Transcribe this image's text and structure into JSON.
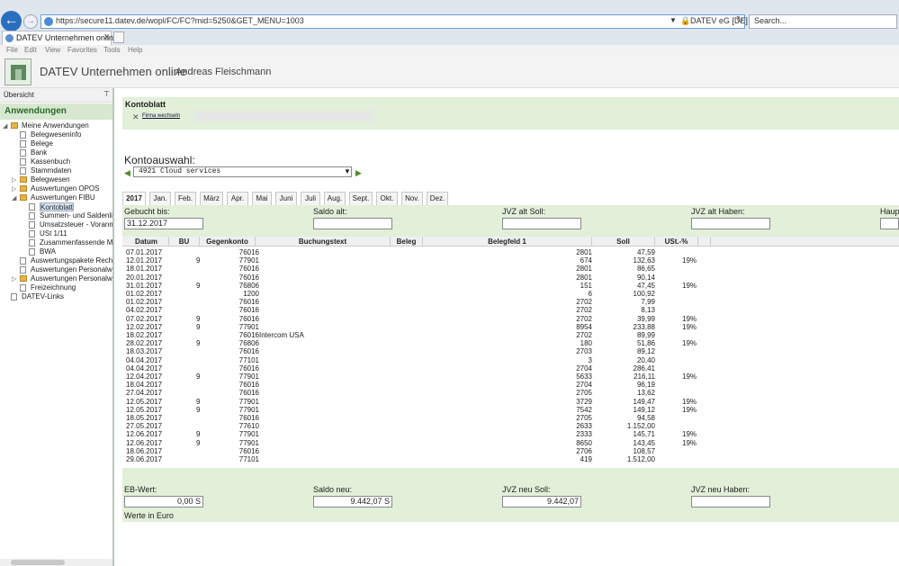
{
  "browser": {
    "url": "https://secure11.datev.de/wopl/FC/FC?mid=5250&GET_MENU=1003",
    "cert": "DATEV eG [DE]",
    "search_placeholder": "Search...",
    "tab_title": "DATEV Unternehmen online",
    "menu": [
      "File",
      "Edit",
      "View",
      "Favorites",
      "Tools",
      "Help"
    ]
  },
  "header": {
    "app_title": "DATEV Unternehmen online",
    "user": "Andreas Fleischmann"
  },
  "sidebar": {
    "head": "Übersicht",
    "section": "Anwendungen",
    "items": [
      "Meine Anwendungen",
      "Belegweseninfo",
      "Belege",
      "Bank",
      "Kassenbuch",
      "Stammdaten",
      "Belegwesen",
      "Auswertungen OPOS",
      "Auswertungen FIBU",
      "Kontoblatt",
      "Summen- und Saldenlis",
      "Umsatzsteuer - Voranm",
      "USt 1/11",
      "Zusammenfassende Me",
      "BWA",
      "Auswertungspakete Rechnu",
      "Auswertungen Personalwirt",
      "Auswertungen Personalwirt",
      "Freizeichnung",
      "DATEV-Links"
    ]
  },
  "kontoblatt": {
    "title": "Kontoblatt",
    "firma_link": "Firma wechseln"
  },
  "kontoauswahl": {
    "label": "Kontoauswahl:",
    "selected": "4921 Cloud services"
  },
  "months": [
    "2017",
    "Jan.",
    "Feb.",
    "März",
    "Apr.",
    "Mai",
    "Juni",
    "Juli",
    "Aug.",
    "Sept.",
    "Okt.",
    "Nov.",
    "Dez."
  ],
  "filters": [
    {
      "label": "Gebucht bis:",
      "value": "31.12.2017"
    },
    {
      "label": "Saldo alt:",
      "value": ""
    },
    {
      "label": "JVZ alt Soll:",
      "value": ""
    },
    {
      "label": "JVZ alt Haben:",
      "value": ""
    },
    {
      "label": "Haup",
      "value": ""
    }
  ],
  "columns": [
    "Datum",
    "BU",
    "Gegenkonto",
    "Buchungstext",
    "Beleg",
    "Belegfeld 1",
    "Soll",
    "USt.-%"
  ],
  "rows": [
    [
      "07.01.2017",
      "",
      "76016",
      "",
      "",
      "2801",
      "47,59",
      ""
    ],
    [
      "12.01.2017",
      "9",
      "77901",
      "",
      "",
      "674",
      "132,63",
      "19%"
    ],
    [
      "18.01.2017",
      "",
      "76016",
      "",
      "",
      "2801",
      "86,65",
      ""
    ],
    [
      "20.01.2017",
      "",
      "76016",
      "",
      "",
      "2801",
      "90,14",
      ""
    ],
    [
      "31.01.2017",
      "9",
      "76806",
      "",
      "",
      "151",
      "47,45",
      "19%"
    ],
    [
      "01.02.2017",
      "",
      "1200",
      "",
      "",
      "6",
      "100,92",
      ""
    ],
    [
      "01.02.2017",
      "",
      "76016",
      "",
      "",
      "2702",
      "7,99",
      ""
    ],
    [
      "04.02.2017",
      "",
      "76016",
      "",
      "",
      "2702",
      "8,13",
      ""
    ],
    [
      "07.02.2017",
      "9",
      "76016",
      "",
      "",
      "2702",
      "39,99",
      "19%"
    ],
    [
      "12.02.2017",
      "9",
      "77901",
      "",
      "",
      "8954",
      "233,88",
      "19%"
    ],
    [
      "18.02.2017",
      "",
      "76016",
      "Intercom USA",
      "",
      "2702",
      "89,99",
      ""
    ],
    [
      "28.02.2017",
      "9",
      "76806",
      "",
      "",
      "180",
      "51,86",
      "19%"
    ],
    [
      "18.03.2017",
      "",
      "76016",
      "",
      "",
      "2703",
      "89,12",
      ""
    ],
    [
      "04.04.2017",
      "",
      "77101",
      "",
      "",
      "3",
      "20,40",
      ""
    ],
    [
      "04.04.2017",
      "",
      "76016",
      "",
      "",
      "2704",
      "286,41",
      ""
    ],
    [
      "12.04.2017",
      "9",
      "77901",
      "",
      "",
      "5633",
      "216,11",
      "19%"
    ],
    [
      "18.04.2017",
      "",
      "76016",
      "",
      "",
      "2704",
      "96,19",
      ""
    ],
    [
      "27.04.2017",
      "",
      "76016",
      "",
      "",
      "2705",
      "13,62",
      ""
    ],
    [
      "12.05.2017",
      "9",
      "77901",
      "",
      "",
      "3729",
      "149,47",
      "19%"
    ],
    [
      "12.05.2017",
      "9",
      "77901",
      "",
      "",
      "7542",
      "149,12",
      "19%"
    ],
    [
      "18.05.2017",
      "",
      "76016",
      "",
      "",
      "2705",
      "94,58",
      ""
    ],
    [
      "27.05.2017",
      "",
      "77610",
      "",
      "",
      "2633",
      "1.152,00",
      ""
    ],
    [
      "12.06.2017",
      "9",
      "77901",
      "",
      "",
      "2333",
      "145,71",
      "19%"
    ],
    [
      "12.06.2017",
      "9",
      "77901",
      "",
      "",
      "8650",
      "143,45",
      "19%"
    ],
    [
      "18.06.2017",
      "",
      "76016",
      "",
      "",
      "2706",
      "108,57",
      ""
    ],
    [
      "29.06.2017",
      "",
      "77101",
      "",
      "",
      "419",
      "1.512,00",
      ""
    ]
  ],
  "bottom": [
    {
      "label": "EB-Wert:",
      "value": "0,00 S"
    },
    {
      "label": "Saldo neu:",
      "value": "9.442,07 S"
    },
    {
      "label": "JVZ neu Soll:",
      "value": "9.442,07"
    },
    {
      "label": "JVZ neu Haben:",
      "value": ""
    }
  ],
  "currency_note": "Werte in Euro"
}
